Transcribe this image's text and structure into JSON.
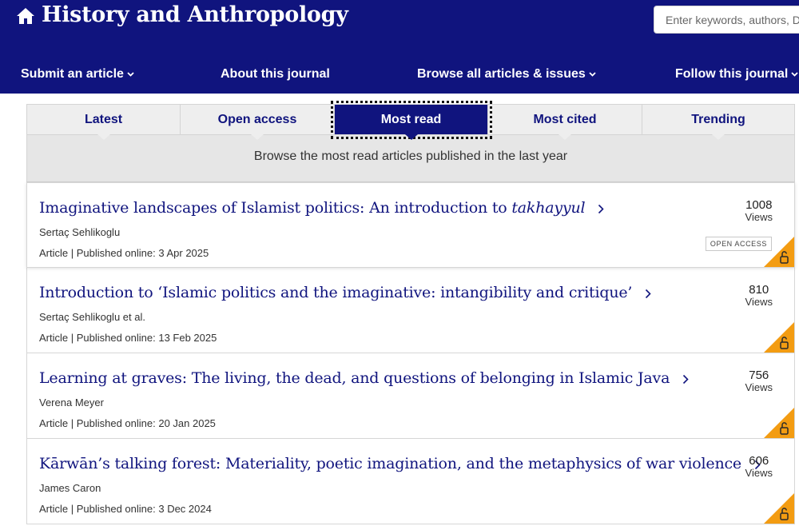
{
  "header": {
    "home_icon": "home-icon",
    "title": "History and Anthropology",
    "search_placeholder": "Enter keywords, authors, DOI, etc.",
    "background_color": "#10147e"
  },
  "nav": {
    "items": [
      {
        "label": "Submit an article",
        "has_dropdown": true
      },
      {
        "label": "About this journal",
        "has_dropdown": false
      },
      {
        "label": "Browse all articles & issues",
        "has_dropdown": true
      },
      {
        "label": "Follow this journal",
        "has_dropdown": true
      }
    ]
  },
  "tabs": {
    "items": [
      {
        "label": "Latest",
        "active": false
      },
      {
        "label": "Open access",
        "active": false
      },
      {
        "label": "Most read",
        "active": true
      },
      {
        "label": "Most cited",
        "active": false
      },
      {
        "label": "Trending",
        "active": false
      }
    ],
    "description": "Browse the most read articles published in the last year"
  },
  "articles": [
    {
      "title_prefix": "Imaginative landscapes of Islamist politics: An introduction to ",
      "title_italic": "takhayyul",
      "author": "Sertaç Sehlikoglu",
      "meta": "Article | Published online: 3 Apr 2025",
      "views": "1008",
      "views_label": "Views",
      "badge": "OPEN ACCESS"
    },
    {
      "title_prefix": "Introduction to ‘Islamic politics and the imaginative: intangibility and critique’",
      "title_italic": "",
      "author": "Sertaç Sehlikoglu et al.",
      "meta": "Article | Published online: 13 Feb 2025",
      "views": "810",
      "views_label": "Views"
    },
    {
      "title_prefix": "Learning at graves: The living, the dead, and questions of belonging in Islamic Java",
      "title_italic": "",
      "author": "Verena Meyer",
      "meta": "Article | Published online: 20 Jan 2025",
      "views": "756",
      "views_label": "Views"
    },
    {
      "title_prefix": "Kārwān’s talking forest: Materiality, poetic imagination, and the metaphysics of war violence",
      "title_italic": "",
      "author": "James Caron",
      "meta": "Article | Published online: 3 Dec 2024",
      "views": "606",
      "views_label": "Views"
    }
  ],
  "colors": {
    "brand": "#10147e",
    "open_access_orange": "#f39c12"
  }
}
